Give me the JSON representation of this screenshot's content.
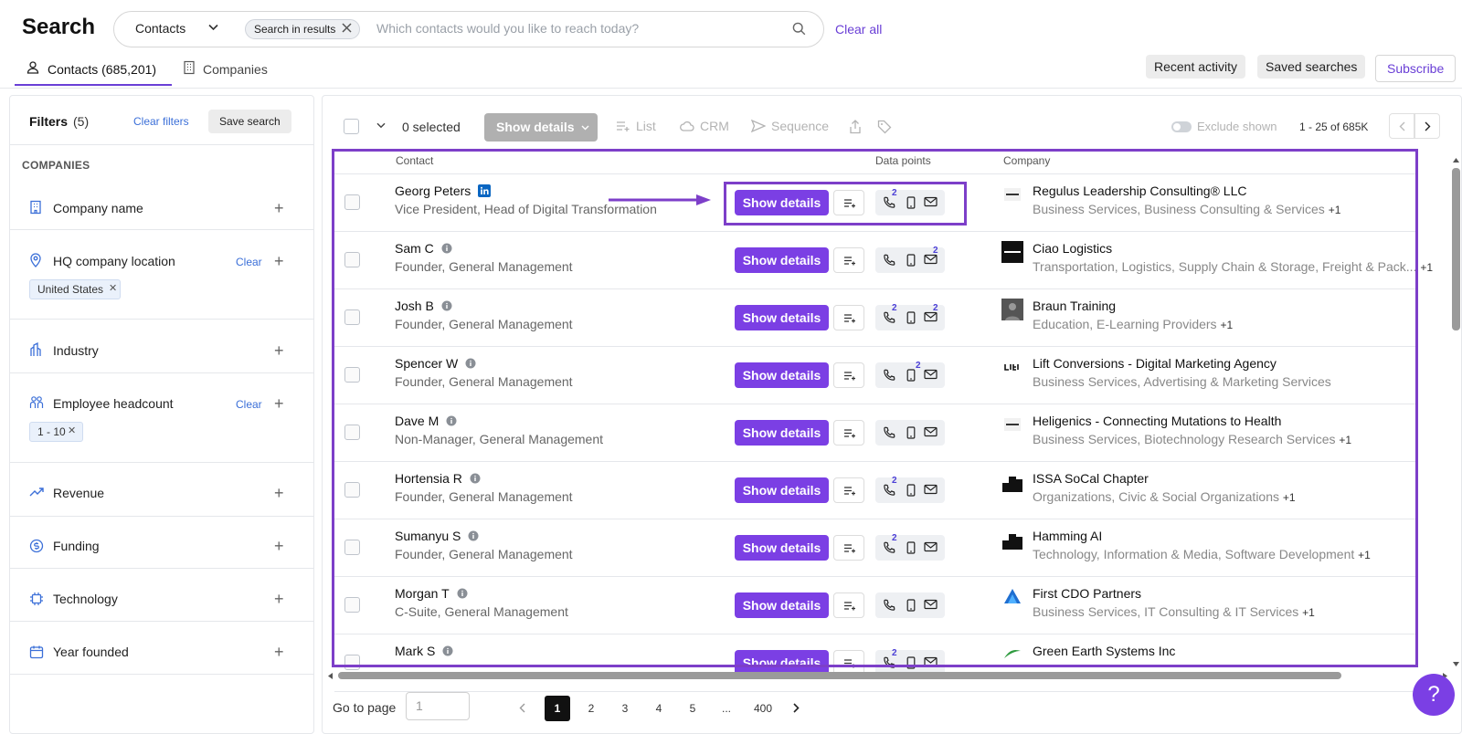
{
  "header": {
    "title": "Search",
    "scope": "Contacts",
    "chip": "Search in results",
    "placeholder": "Which contacts would you like to reach today?",
    "clear_all": "Clear all",
    "tabs": [
      {
        "label": "Contacts (685,201)"
      },
      {
        "label": "Companies"
      }
    ],
    "recent_activity": "Recent activity",
    "saved_searches": "Saved searches",
    "subscribe": "Subscribe"
  },
  "filters": {
    "title": "Filters",
    "count": "(5)",
    "clear_filters": "Clear filters",
    "save_search": "Save search",
    "section_heading": "COMPANIES",
    "items": [
      {
        "label": "Company name",
        "icon": "building-icon"
      },
      {
        "label": "HQ company location",
        "icon": "location-pin-icon",
        "clear": "Clear",
        "chip": "United States"
      },
      {
        "label": "Industry",
        "icon": "industry-icon"
      },
      {
        "label": "Employee headcount",
        "icon": "people-icon",
        "clear": "Clear",
        "chip": "1 - 10"
      },
      {
        "label": "Revenue",
        "icon": "trend-up-icon"
      },
      {
        "label": "Funding",
        "icon": "dollar-circle-icon"
      },
      {
        "label": "Technology",
        "icon": "chip-icon"
      },
      {
        "label": "Year founded",
        "icon": "calendar-icon"
      }
    ],
    "plus": "+"
  },
  "toolbar": {
    "selected": "0 selected",
    "show_details": "Show details",
    "list": "List",
    "crm": "CRM",
    "sequence": "Sequence",
    "exclude_shown": "Exclude shown",
    "range": "1 - 25 of 685K"
  },
  "table": {
    "columns": {
      "contact": "Contact",
      "data_points": "Data points",
      "company": "Company"
    },
    "show_details_label": "Show details",
    "rows": [
      {
        "name": "Georg Peters",
        "badge": "linkedin",
        "title": "Vice President, Head of Digital Transformation",
        "company": "Regulus Leadership Consulting® LLC",
        "industry": "Business Services, Business Consulting & Services",
        "plus": "+1",
        "phone_badge": "2",
        "mobile_badge": "",
        "email_badge": ""
      },
      {
        "name": "Sam C",
        "badge": "info",
        "title": "Founder, General Management",
        "company": "Ciao Logistics",
        "industry": "Transportation, Logistics, Supply Chain & Storage, Freight & Pack...",
        "plus": "+1",
        "phone_badge": "",
        "mobile_badge": "",
        "email_badge": "2"
      },
      {
        "name": "Josh B",
        "badge": "info",
        "title": "Founder, General Management",
        "company": "Braun Training",
        "industry": "Education, E-Learning Providers",
        "plus": "+1",
        "phone_badge": "2",
        "mobile_badge": "",
        "email_badge": "2"
      },
      {
        "name": "Spencer W",
        "badge": "info",
        "title": "Founder, General Management",
        "company": "Lift Conversions - Digital Marketing Agency",
        "industry": "Business Services, Advertising & Marketing Services",
        "plus": "",
        "phone_badge": "",
        "mobile_badge": "2",
        "email_badge": ""
      },
      {
        "name": "Dave M",
        "badge": "info",
        "title": "Non-Manager, General Management",
        "company": "Heligenics - Connecting Mutations to Health",
        "industry": "Business Services, Biotechnology Research Services",
        "plus": "+1",
        "phone_badge": "",
        "mobile_badge": "",
        "email_badge": ""
      },
      {
        "name": "Hortensia R",
        "badge": "info",
        "title": "Founder, General Management",
        "company": "ISSA SoCal Chapter",
        "industry": "Organizations, Civic & Social Organizations",
        "plus": "+1",
        "phone_badge": "2",
        "mobile_badge": "",
        "email_badge": ""
      },
      {
        "name": "Sumanyu S",
        "badge": "info",
        "title": "Founder, General Management",
        "company": "Hamming AI",
        "industry": "Technology, Information & Media, Software Development",
        "plus": "+1",
        "phone_badge": "2",
        "mobile_badge": "",
        "email_badge": ""
      },
      {
        "name": "Morgan T",
        "badge": "info",
        "title": "C-Suite, General Management",
        "company": "First CDO Partners",
        "industry": "Business Services, IT Consulting & IT Services",
        "plus": "+1",
        "phone_badge": "",
        "mobile_badge": "",
        "email_badge": ""
      },
      {
        "name": "Mark S",
        "badge": "info",
        "title": "",
        "company": "Green Earth Systems Inc",
        "industry": "",
        "plus": "",
        "phone_badge": "2",
        "mobile_badge": "",
        "email_badge": ""
      }
    ]
  },
  "pagination": {
    "go_to_page": "Go to page",
    "input_placeholder": "1",
    "pages": [
      "1",
      "2",
      "3",
      "4",
      "5",
      "...",
      "400"
    ],
    "current": "1"
  },
  "help": "?",
  "colors": {
    "accent": "#7b3fe4",
    "link": "#3b6fd8",
    "highlight": "#7d3fc9"
  }
}
